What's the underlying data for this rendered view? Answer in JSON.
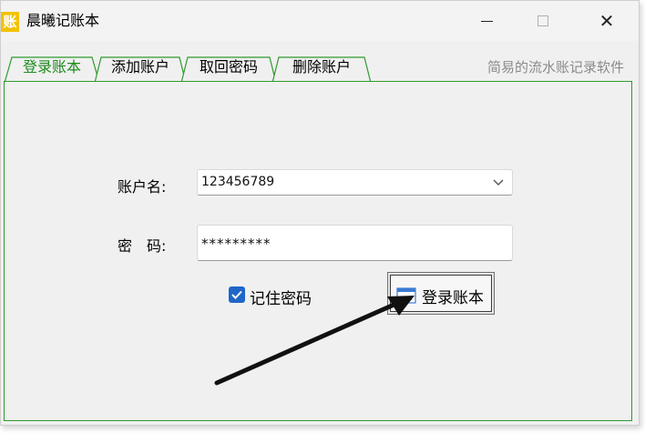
{
  "window": {
    "title": "晨曦记账本",
    "icon_glyph": "账",
    "close_glyph": "✕"
  },
  "tabs": [
    {
      "label": "登录账本",
      "active": true
    },
    {
      "label": "添加账户",
      "active": false
    },
    {
      "label": "取回密码",
      "active": false
    },
    {
      "label": "删除账户",
      "active": false
    }
  ],
  "header_hint": "简易的流水账记录软件",
  "form": {
    "account_label": "账户名:",
    "account_value": "123456789",
    "password_label": "密　码:",
    "password_value": "*********",
    "remember_label": "记住密码",
    "remember_checked": true,
    "login_button": "登录账本"
  },
  "colors": {
    "tab_border": "#2f9a2f",
    "active_tab_text": "#1e8a1e",
    "checkbox": "#1f66c8",
    "app_icon": "#f2c200"
  },
  "icons": [
    "app-icon",
    "minimize-icon",
    "maximize-icon",
    "close-icon",
    "chevron-down-icon",
    "check-icon",
    "window-icon",
    "arrow-annotation"
  ]
}
